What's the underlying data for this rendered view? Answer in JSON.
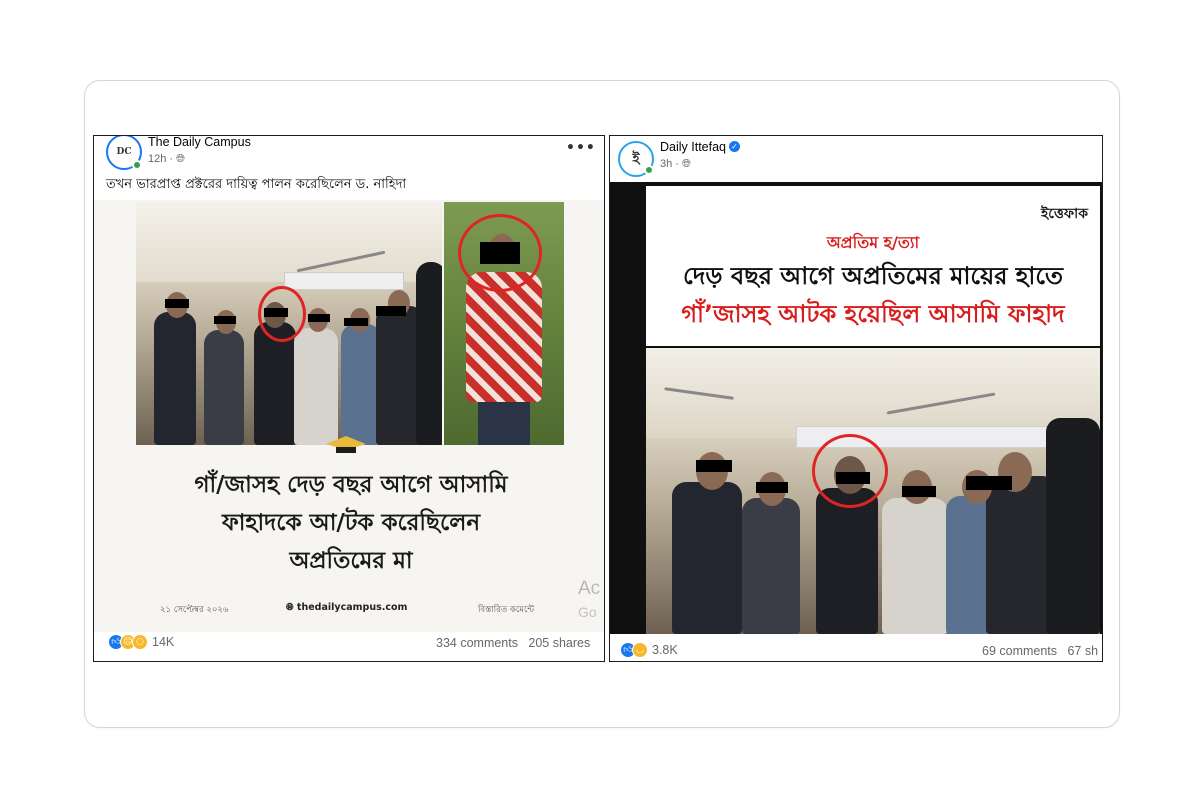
{
  "post1": {
    "page_name": "The Daily Campus",
    "time": "12h",
    "caption": "তখন ভারপ্রাপ্ত প্রক্টরের দায়িত্ব পালন করেছিলেন ড. নাহিদা",
    "more": "•••",
    "card": {
      "headline_lines": [
        "গাঁ/জাসহ দেড় বছর আগে আসামি",
        "ফাহাদকে আ/টক করেছিলেন",
        "অপ্রতিমের মা"
      ],
      "date": "২১ সেপ্টেম্বর ২০২৬",
      "site": "thedailycampus.com",
      "details": "বিস্তারিত কমেন্টে"
    },
    "watermark": [
      "Ac",
      "Go"
    ],
    "reactions_count": "14K",
    "comments": "334 comments",
    "shares": "205 shares"
  },
  "post2": {
    "page_name": "Daily Ittefaq",
    "time": "3h",
    "card": {
      "logo": "ইত্তেফাক",
      "kicker": "অপ্রতিম হ/ত্যা",
      "headline_line1": "দেড় বছর আগে অপ্রতিমের মায়ের হাতে",
      "headline_line2": "গাঁ’জাসহ আটক হয়েছিল আসামি ফাহাদ"
    },
    "reactions_count": "3.8K",
    "comments": "69 comments",
    "shares": "67 sh"
  },
  "colors": {
    "accent": "#1877f2",
    "headline_red": "#d91d1d",
    "circle_red": "#e02424"
  }
}
